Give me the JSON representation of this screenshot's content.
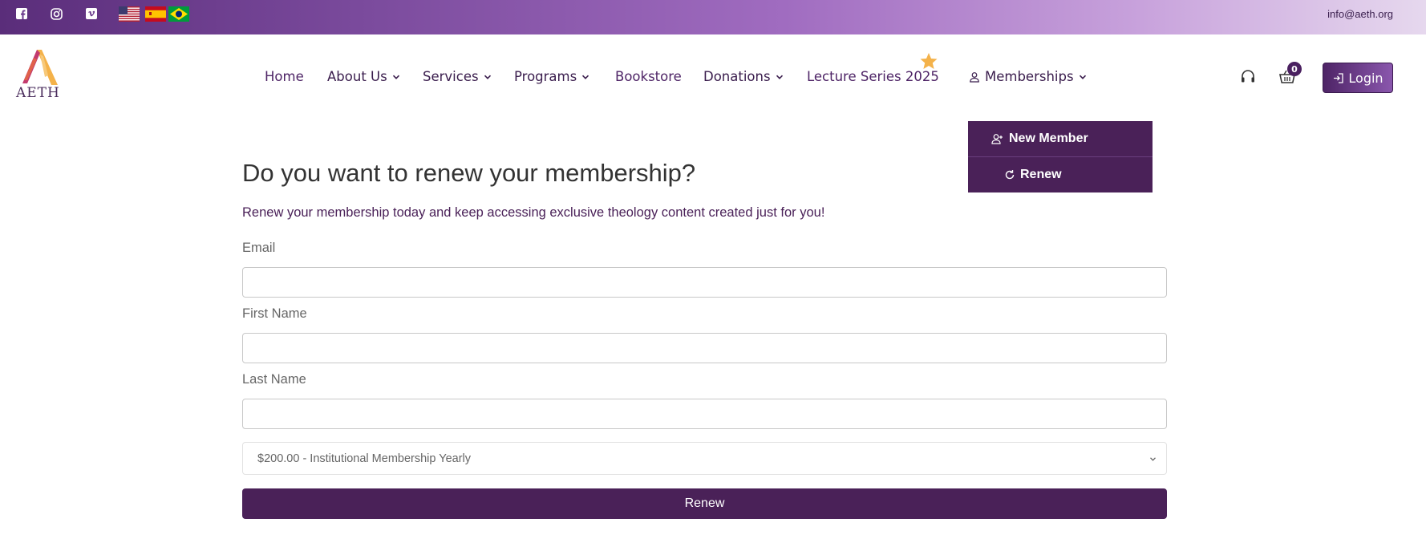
{
  "topbar": {
    "email": "info@aeth.org",
    "social": [
      {
        "icon": "facebook-icon"
      },
      {
        "icon": "instagram-icon"
      },
      {
        "icon": "vimeo-icon"
      }
    ],
    "flags": [
      {
        "icon": "flag-us-icon"
      },
      {
        "icon": "flag-spain-icon"
      },
      {
        "icon": "flag-brazil-icon"
      }
    ]
  },
  "logo": {
    "text": "AETH"
  },
  "nav": {
    "home": "Home",
    "about": "About Us",
    "services": "Services",
    "programs": "Programs",
    "bookstore": "Bookstore",
    "donations": "Donations",
    "lectures": "Lecture Series 2025",
    "memberships": "Memberships",
    "cart_count": "0",
    "login": "Login"
  },
  "dropdown": {
    "new_member": "New Member",
    "renew": "Renew"
  },
  "page": {
    "title": "Do you want to renew your membership?",
    "lead": "Renew your membership today and keep accessing exclusive theology content created just for you!"
  },
  "form": {
    "email_label": "Email",
    "email_value": "",
    "first_label": "First Name",
    "first_value": "",
    "last_label": "Last Name",
    "last_value": "",
    "plan_selected": "$200.00 - Institutional Membership Yearly",
    "submit": "Renew"
  },
  "colors": {
    "brand": "#4a2158",
    "accent_gradient_start": "#5a2d7a",
    "star": "#f4b24a"
  }
}
